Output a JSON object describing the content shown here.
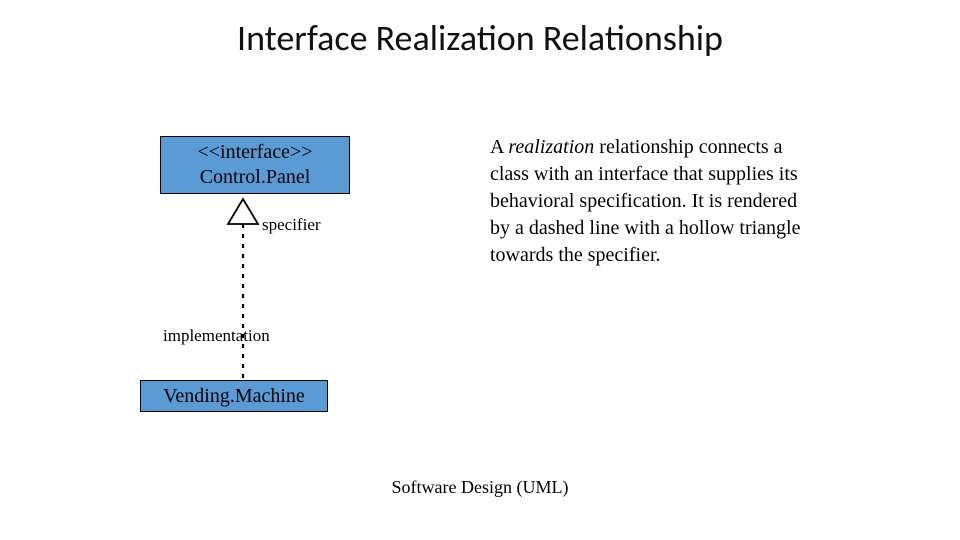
{
  "title": "Interface Realization Relationship",
  "diagram": {
    "interface_box": {
      "stereotype": "<<interface>>",
      "name": "Control.Panel"
    },
    "vending_box": {
      "name": "Vending.Machine"
    },
    "labels": {
      "specifier": "specifier",
      "implementation": "implementation"
    }
  },
  "body": {
    "pre": "A ",
    "italic": "realization",
    "post": " relationship connects a class with an interface that supplies its behavioral specification. It is rendered by a dashed line with a hollow triangle towards the specifier."
  },
  "footer": "Software Design (UML)",
  "colors": {
    "box_fill": "#5b9bd5",
    "line": "#000000"
  },
  "chart_data": {
    "type": "uml-realization",
    "specifier": {
      "stereotype": "interface",
      "name": "Control.Panel"
    },
    "implementation": {
      "name": "Vending.Machine"
    },
    "arrow": {
      "style": "dashed",
      "head": "hollow-triangle",
      "direction": "implementation-to-specifier"
    }
  }
}
